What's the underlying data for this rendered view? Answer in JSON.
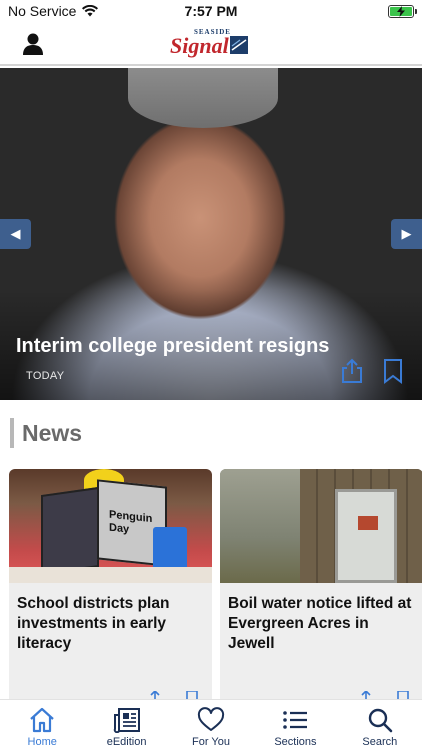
{
  "status_bar": {
    "carrier": "No Service",
    "time": "7:57 PM",
    "battery_percent": 100
  },
  "header": {
    "logo_top": "SEASIDE",
    "logo_main": "Signal",
    "profile_icon": "person-icon"
  },
  "hero": {
    "title": "Interim college president resigns",
    "date": "TODAY",
    "prev_icon": "left-arrow-icon",
    "next_icon": "right-arrow-icon",
    "share_icon": "share-icon",
    "bookmark_icon": "bookmark-icon"
  },
  "news": {
    "heading": "News",
    "cards": [
      {
        "title": "School districts plan investments in early literacy",
        "image_text": "Penguin Day"
      },
      {
        "title": "Boil water notice lifted at Evergreen Acres in Jewell",
        "image_text": ""
      }
    ]
  },
  "tabs": [
    {
      "label": "Home",
      "icon": "home-icon",
      "active": true
    },
    {
      "label": "eEdition",
      "icon": "newspaper-icon",
      "active": false
    },
    {
      "label": "For You",
      "icon": "heart-icon",
      "active": false
    },
    {
      "label": "Sections",
      "icon": "list-icon",
      "active": false
    },
    {
      "label": "Search",
      "icon": "search-icon",
      "active": false
    }
  ],
  "colors": {
    "accent": "#3a7bd5",
    "nav_dark": "#1a2f55",
    "arrow_bg": "#3e5f8e",
    "logo_red": "#c1272d",
    "battery_green": "#3bc44b"
  }
}
